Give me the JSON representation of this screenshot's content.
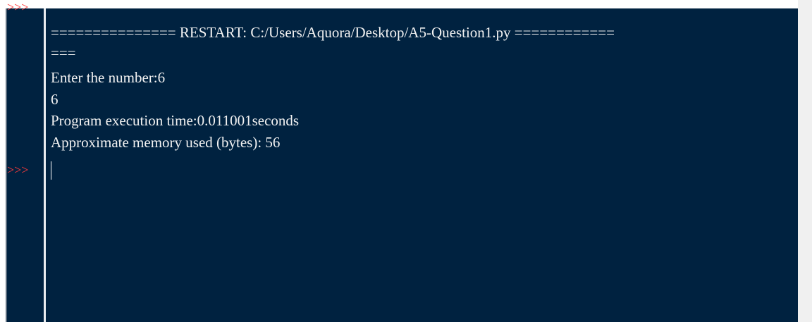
{
  "shell": {
    "prompt_symbol": ">>>",
    "lines": [
      "=============== RESTART: C:/Users/Aquora/Desktop/A5-Question1.py ============",
      "===",
      "Enter the number:6",
      "6",
      "Program execution time:0.011001seconds",
      "Approximate memory used (bytes): 56"
    ]
  },
  "colors": {
    "background": "#002240",
    "text": "#f2f2f2",
    "prompt": "#ff3b3b"
  }
}
